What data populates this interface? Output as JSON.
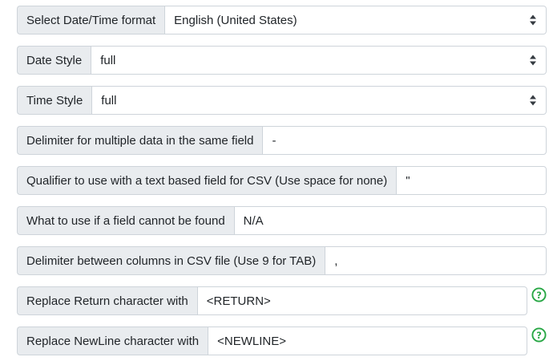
{
  "fields": [
    {
      "label": "Select Date/Time format",
      "value": "English (United States)",
      "type": "select"
    },
    {
      "label": "Date Style",
      "value": "full",
      "type": "select"
    },
    {
      "label": "Time Style",
      "value": "full",
      "type": "select"
    },
    {
      "label": "Delimiter for multiple data in the same field",
      "value": "-",
      "type": "text"
    },
    {
      "label": "Qualifier to use with a text based field for CSV (Use space for none)",
      "value": "\"",
      "type": "text"
    },
    {
      "label": "What to use if a field cannot be found",
      "value": "N/A",
      "type": "text"
    },
    {
      "label": "Delimiter between columns in CSV file (Use 9 for TAB)",
      "value": ",",
      "type": "text"
    },
    {
      "label": "Replace Return character with",
      "value": "<RETURN>",
      "type": "text",
      "help": true
    },
    {
      "label": "Replace NewLine character with",
      "value": "<NEWLINE>",
      "type": "text",
      "help": true
    }
  ],
  "icons": {
    "select_caret": "up-down-caret-icon",
    "help": "question-circle-icon"
  },
  "colors": {
    "label_bg": "#e9ecef",
    "border": "#ced4da",
    "help_green": "#28a745"
  }
}
